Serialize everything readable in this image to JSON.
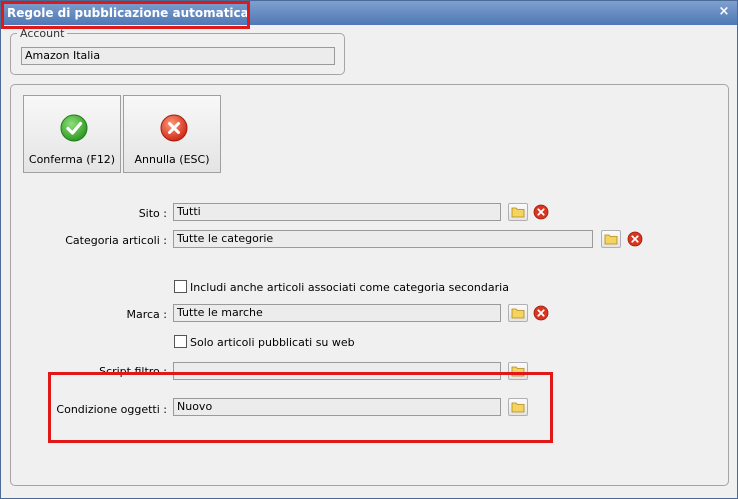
{
  "window": {
    "title": "Regole di pubblicazione automatica",
    "close_icon": "×"
  },
  "account": {
    "legend": "Account",
    "value": "Amazon Italia"
  },
  "toolbar": {
    "confirm_label": "Conferma (F12)",
    "cancel_label": "Annulla (ESC)"
  },
  "form": {
    "sito": {
      "label": "Sito :",
      "value": "Tutti"
    },
    "categoria": {
      "label": "Categoria articoli :",
      "value": "Tutte le categorie"
    },
    "includi": {
      "label": "Includi anche articoli associati come categoria secondaria"
    },
    "marca": {
      "label": "Marca :",
      "value": "Tutte le marche"
    },
    "solo_web": {
      "label": "Solo articoli pubblicati su web"
    },
    "script": {
      "label": "Script filtro :",
      "value": ""
    },
    "condizione": {
      "label": "Condizione oggetti :",
      "value": "Nuovo"
    }
  },
  "colors": {
    "highlight": "#e01818",
    "confirm": "#3aa82c",
    "cancel": "#d93a25"
  }
}
